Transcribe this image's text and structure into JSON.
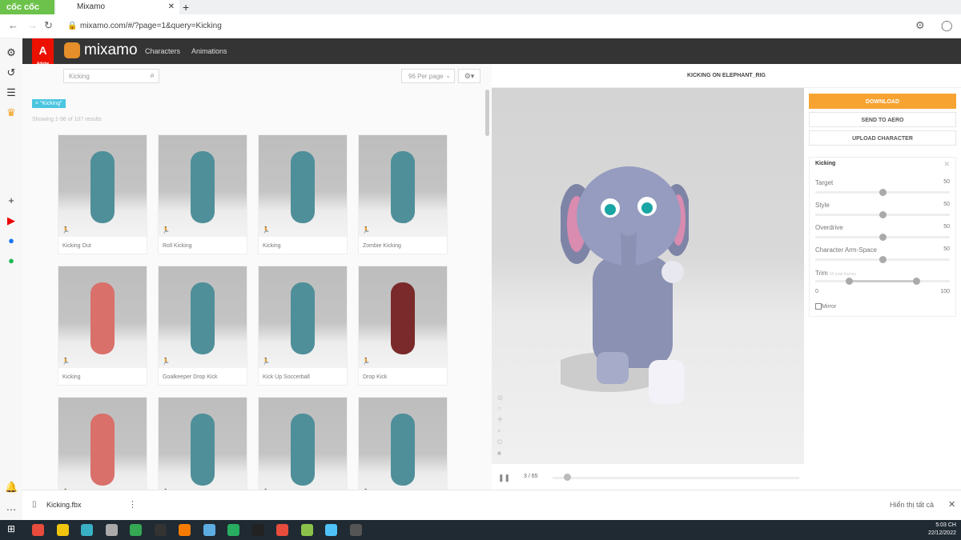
{
  "browser": {
    "brand": "cốc cốc",
    "tab_title": "Mixamo",
    "url": "mixamo.com/#/?page=1&query=Kicking"
  },
  "app": {
    "brand": "mixamo",
    "adobe": "Adobe",
    "nav": [
      "Characters",
      "Animations"
    ]
  },
  "toolbar": {
    "search_value": "Kicking",
    "per_page": "96 Per page"
  },
  "filter_chip": "× \"Kicking\"",
  "results_count": "Showing 1-96 of 107 results",
  "cards": [
    {
      "label": "Kicking Out",
      "color": "#4f8f99"
    },
    {
      "label": "Roll Kicking",
      "color": "#4f8f99"
    },
    {
      "label": "Kicking",
      "color": "#4f8f99"
    },
    {
      "label": "Zombie Kicking",
      "color": "#4f8f99"
    },
    {
      "label": "Kicking",
      "color": "#d9706a"
    },
    {
      "label": "Goalkeeper Drop Kick",
      "color": "#4f8f99"
    },
    {
      "label": "Kick Up Soccerball",
      "color": "#4f8f99"
    },
    {
      "label": "Drop Kick",
      "color": "#7a2a2a"
    },
    {
      "label": "",
      "color": "#d9706a"
    },
    {
      "label": "",
      "color": "#4f8f99"
    },
    {
      "label": "",
      "color": "#4f8f99"
    },
    {
      "label": "",
      "color": "#4f8f99"
    }
  ],
  "viewer": {
    "title": "KICKING ON ELEPHANT_RIG",
    "frame": "3 / 65",
    "current_frame": 3,
    "total_frames": 65
  },
  "actions": {
    "download": "DOWNLOAD",
    "send": "SEND TO AERO",
    "upload": "UPLOAD CHARACTER"
  },
  "panel": {
    "title": "Kicking",
    "sliders": [
      {
        "label": "Target",
        "value": "50"
      },
      {
        "label": "Style",
        "value": "50"
      },
      {
        "label": "Overdrive",
        "value": "50"
      },
      {
        "label": "Character Arm-Space",
        "value": "50"
      }
    ],
    "trim": {
      "label": "Trim",
      "note": "65 total frames",
      "min": "0",
      "max": "100",
      "low": 25,
      "high": 75
    },
    "mirror": "Mirror",
    "mirror_checked": false
  },
  "downloads": {
    "file": "Kicking.fbx",
    "show_all": "Hiển thị tất cả"
  },
  "clock": {
    "time": "5:03 CH",
    "date": "22/12/2022"
  },
  "colors": {
    "accent": "#f7a332",
    "header": "#343434",
    "adobe": "#eb1000",
    "chip": "#4ac5e0"
  }
}
